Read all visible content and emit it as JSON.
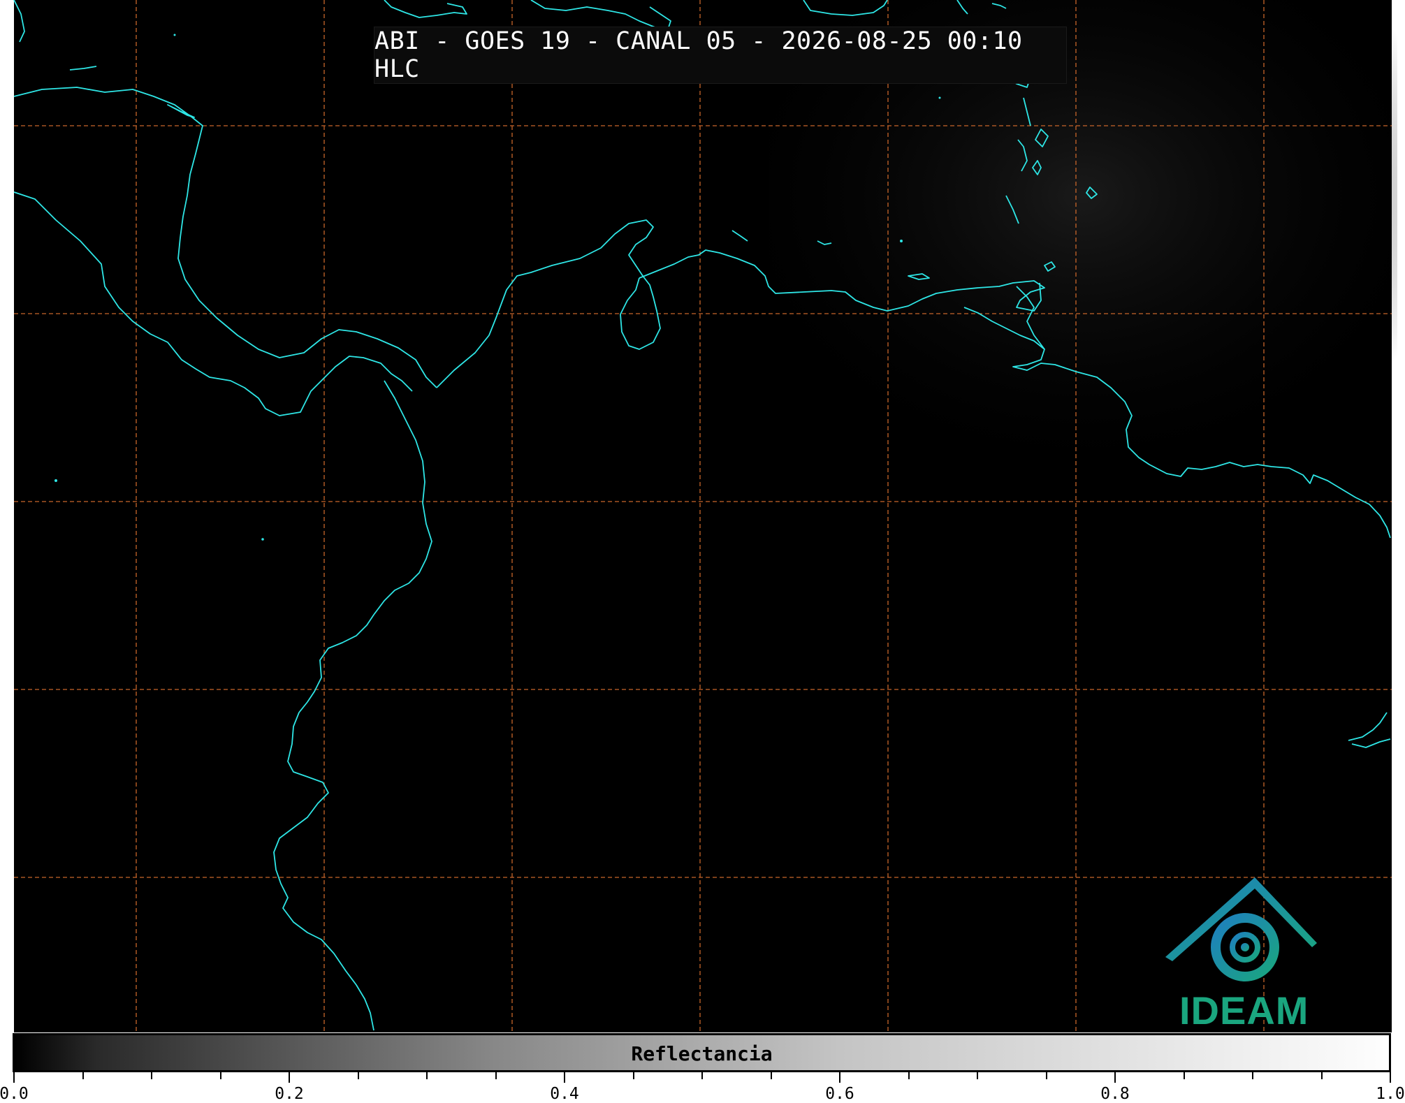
{
  "header": {
    "title": "ABI - GOES 19 - CANAL 05 - 2026-08-25 00:10 HLC"
  },
  "map": {
    "background_color": "#000000",
    "coastline_color": "#2ee6e6",
    "gridline_color": "#c8652a",
    "gridline_style": "dashed"
  },
  "colorbar": {
    "label": "Reflectancia",
    "colormap": "grayscale",
    "range": [
      0.0,
      1.0
    ],
    "tick_labels": [
      "0.0",
      "0.2",
      "0.4",
      "0.6",
      "0.8",
      "1.0"
    ]
  },
  "logo": {
    "text": "IDEAM",
    "icon": "ideam-swirl-logo-icon",
    "colors": [
      "#1e7fbf",
      "#1aa67f"
    ]
  }
}
